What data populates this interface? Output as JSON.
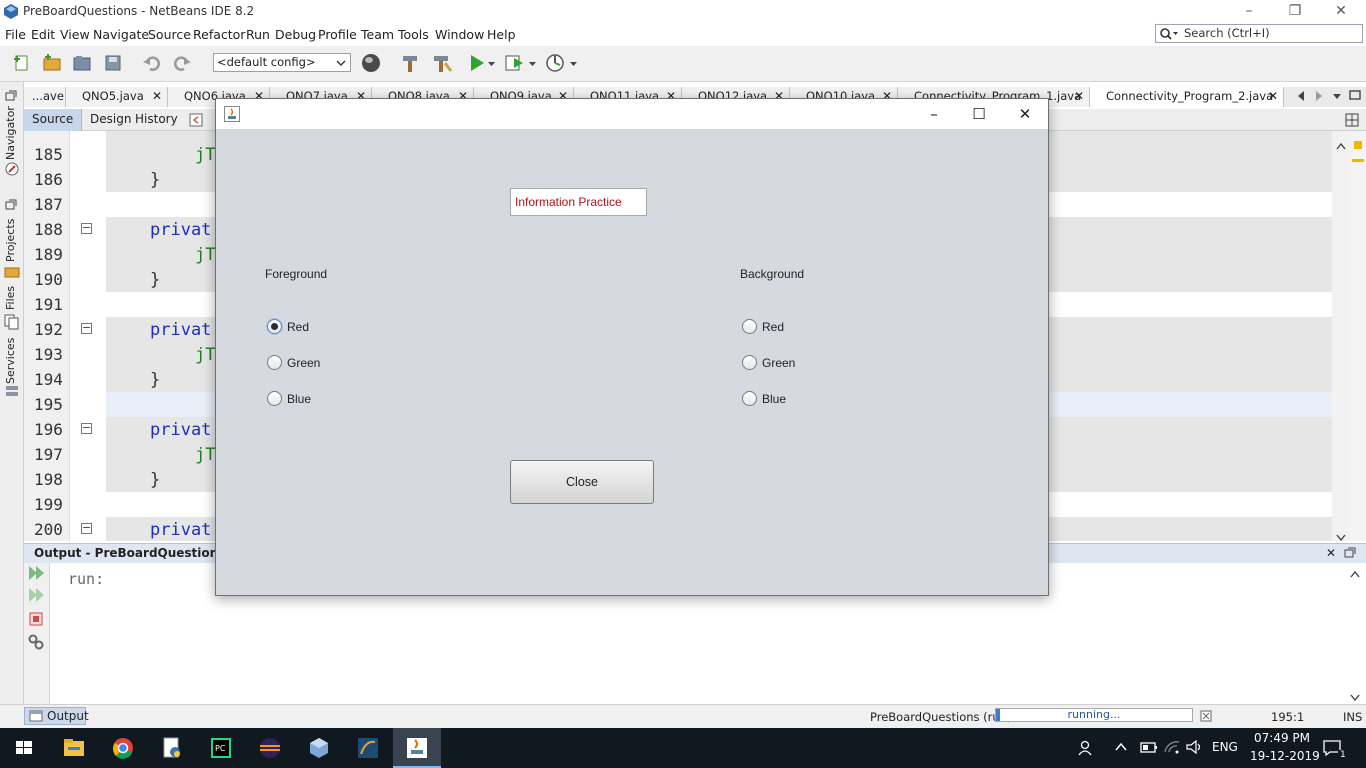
{
  "window": {
    "title": "PreBoardQuestions - NetBeans IDE 8.2",
    "minimize": "–",
    "restore": "❐",
    "close": "✕"
  },
  "menu": [
    "File",
    "Edit",
    "View",
    "Navigate",
    "Source",
    "Refactor",
    "Run",
    "Debug",
    "Profile",
    "Team",
    "Tools",
    "Window",
    "Help"
  ],
  "search": {
    "placeholder": "Search (Ctrl+I)"
  },
  "toolbar": {
    "config": "<default config>"
  },
  "side_tabs": [
    "Navigator",
    "Projects",
    "Files",
    "Services"
  ],
  "file_tabs": [
    {
      "label": "...ave"
    },
    {
      "label": "QNO5.java"
    },
    {
      "label": "QNO6.java"
    },
    {
      "label": "QNO7.java"
    },
    {
      "label": "QNO8.java"
    },
    {
      "label": "QNO9.java"
    },
    {
      "label": "QNO11.java"
    },
    {
      "label": "QNO12.java"
    },
    {
      "label": "QNO10.java"
    },
    {
      "label": "Connectivity_Program_1.java"
    },
    {
      "label": "Connectivity_Program_2.java"
    }
  ],
  "editor_tabs": {
    "source": "Source",
    "design": "Design",
    "history": "History"
  },
  "code": [
    {
      "num": "185",
      "kw": "",
      "id": "jT",
      "br": ""
    },
    {
      "num": "186",
      "kw": "",
      "id": "",
      "br": "}"
    },
    {
      "num": "187",
      "kw": "",
      "id": "",
      "br": ""
    },
    {
      "num": "188",
      "kw": "privat",
      "id": "",
      "br": ""
    },
    {
      "num": "189",
      "kw": "",
      "id": "jT",
      "br": ""
    },
    {
      "num": "190",
      "kw": "",
      "id": "",
      "br": "}"
    },
    {
      "num": "191",
      "kw": "",
      "id": "",
      "br": ""
    },
    {
      "num": "192",
      "kw": "privat",
      "id": "",
      "br": ""
    },
    {
      "num": "193",
      "kw": "",
      "id": "jT",
      "br": ""
    },
    {
      "num": "194",
      "kw": "",
      "id": "",
      "br": "}"
    },
    {
      "num": "195",
      "kw": "",
      "id": "",
      "br": ""
    },
    {
      "num": "196",
      "kw": "privat",
      "id": "",
      "br": ""
    },
    {
      "num": "197",
      "kw": "",
      "id": "jT",
      "br": ""
    },
    {
      "num": "198",
      "kw": "",
      "id": "",
      "br": "}"
    },
    {
      "num": "199",
      "kw": "",
      "id": "",
      "br": ""
    },
    {
      "num": "200",
      "kw": "privat",
      "id": "",
      "br": ""
    }
  ],
  "output": {
    "title": "Output - PreBoardQuestions (run",
    "text": "run:"
  },
  "status": {
    "tab": "Output",
    "project": "PreBoardQuestions (run)",
    "progress_label": "running...",
    "position": "195:1",
    "mode": "INS"
  },
  "taskbar": {
    "lang": "ENG",
    "time": "07:49 PM",
    "date": "19-12-2019",
    "notifications": "1"
  },
  "dialog": {
    "textfield": "Information Practice",
    "foreground": {
      "label": "Foreground",
      "options": [
        "Red",
        "Green",
        "Blue"
      ],
      "selected": "Red"
    },
    "background": {
      "label": "Background",
      "options": [
        "Red",
        "Green",
        "Blue"
      ],
      "selected": ""
    },
    "close_label": "Close"
  }
}
